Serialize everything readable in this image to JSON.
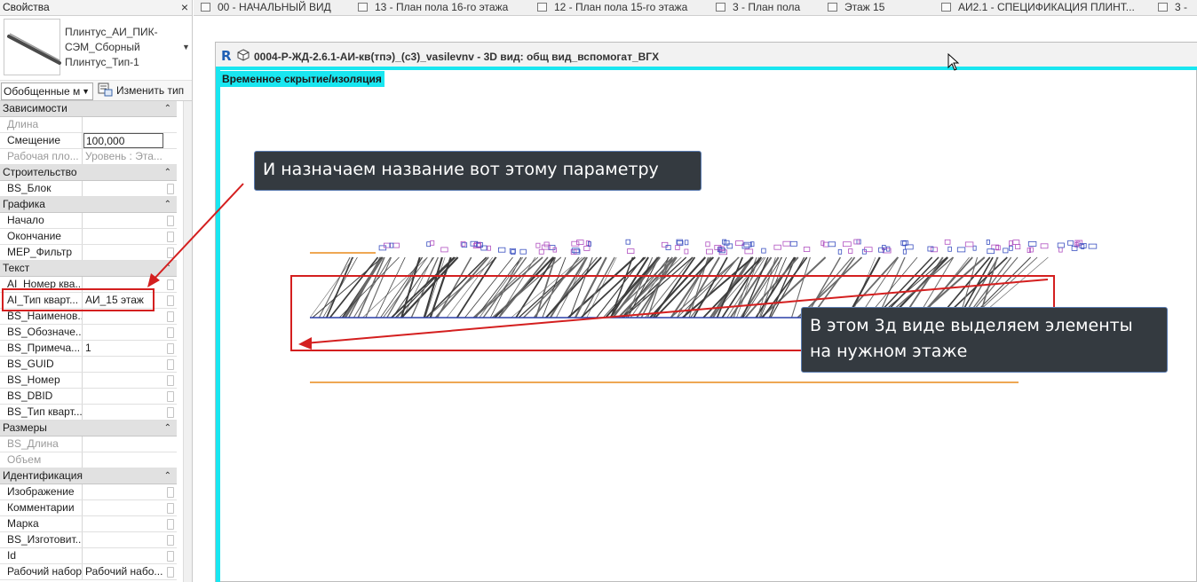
{
  "properties_panel": {
    "title": "Свойства",
    "close_label": "×",
    "type_name": "Плинтус_АИ_ПИК-СЭМ_Сборный Плинтус_Тип-1",
    "filter_value": "Обобщенные м",
    "edit_type_label": "Изменить тип",
    "groups": [
      {
        "name": "Зависимости",
        "rows": [
          {
            "key": "Длина",
            "value": "",
            "disabled": true
          },
          {
            "key": "Смещение",
            "value": "100,000",
            "input": true
          },
          {
            "key": "Рабочая пло...",
            "value": "Уровень : Эта...",
            "disabled": true
          }
        ]
      },
      {
        "name": "Строительство",
        "rows": [
          {
            "key": "BS_Блок",
            "value": ""
          }
        ]
      },
      {
        "name": "Графика",
        "rows": [
          {
            "key": "Начало",
            "value": ""
          },
          {
            "key": "Окончание",
            "value": ""
          },
          {
            "key": "MEP_Фильтр",
            "value": ""
          }
        ]
      },
      {
        "name": "Текст",
        "rows": [
          {
            "key": "AI_Номер ква...",
            "value": ""
          },
          {
            "key": "AI_Тип кварт...",
            "value": "АИ_15 этаж"
          },
          {
            "key": "BS_Наименов...",
            "value": ""
          },
          {
            "key": "BS_Обозначе...",
            "value": ""
          },
          {
            "key": "BS_Примеча...",
            "value": "1"
          },
          {
            "key": "BS_GUID",
            "value": ""
          },
          {
            "key": "BS_Номер",
            "value": ""
          },
          {
            "key": "BS_DBID",
            "value": ""
          },
          {
            "key": "BS_Тип кварт...",
            "value": ""
          }
        ]
      },
      {
        "name": "Размеры",
        "rows": [
          {
            "key": "BS_Длина",
            "value": "",
            "disabled": true
          },
          {
            "key": "Объем",
            "value": "",
            "disabled": true
          }
        ]
      },
      {
        "name": "Идентификация",
        "rows": [
          {
            "key": "Изображение",
            "value": ""
          },
          {
            "key": "Комментарии",
            "value": ""
          },
          {
            "key": "Марка",
            "value": ""
          },
          {
            "key": "BS_Изготовит...",
            "value": ""
          },
          {
            "key": "Id",
            "value": ""
          },
          {
            "key": "Рабочий набор",
            "value": "Рабочий набо..."
          }
        ]
      }
    ]
  },
  "tabs": [
    {
      "label": "00 - НАЧАЛЬНЫЙ ВИД"
    },
    {
      "label": "13 - План пола 16-го этажа"
    },
    {
      "label": "12 - План пола 15-го этажа"
    },
    {
      "label": "3 - План пола"
    },
    {
      "label": "Этаж 15"
    },
    {
      "label": "АИ2.1 - СПЕЦИФИКАЦИЯ ПЛИНТ..."
    },
    {
      "label": "3 -"
    }
  ],
  "view": {
    "title": "0004-Р-ЖД-2.6.1-АИ-кв(тпэ)_(с3)_vasilevnv - 3D вид: общ вид_вспомогат_ВГХ",
    "isolation_badge": "Временное скрытие/изоляция"
  },
  "annotations": {
    "callout_top": "И  назначаем название вот этому параметру",
    "callout_bottom_line1": "В этом 3д виде выделяем элементы",
    "callout_bottom_line2": "на нужном этаже"
  },
  "colors": {
    "accent_cyan": "#19e6f0",
    "highlight_red": "#d41f1f",
    "callout_bg": "#343a40",
    "orange_line": "#e88a1a",
    "blue_line": "#2a3fa8"
  }
}
